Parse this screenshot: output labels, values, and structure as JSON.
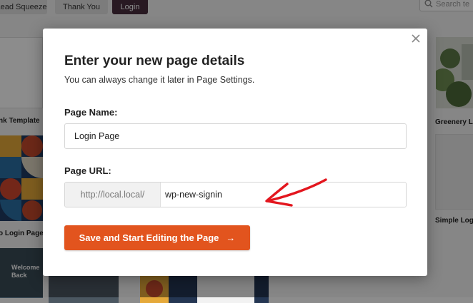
{
  "background": {
    "filter_tabs": [
      {
        "label": "Lead Squeeze"
      },
      {
        "label": "Thank You"
      },
      {
        "label": "Login"
      }
    ],
    "search_placeholder": "Search te",
    "template_labels": {
      "left_top": "nk Template",
      "left_mid": "o Login Page",
      "right_top": "Greenery L",
      "right_mid": "Simple Logi",
      "welcome_text": "Welcome Back"
    }
  },
  "modal": {
    "title": "Enter your new page details",
    "subtitle": "You can always change it later in Page Settings.",
    "page_name": {
      "label": "Page Name:",
      "value": "Login Page"
    },
    "page_url": {
      "label": "Page URL:",
      "prefix": "http://local.local/",
      "value": "wp-new-signin"
    },
    "save_button": {
      "label": "Save and Start Editing the Page",
      "arrow": "→"
    },
    "close_icon": "close-icon"
  },
  "annotation": {
    "arrow_color": "#e3161e",
    "icon": "red-hand-drawn-arrow"
  },
  "colors": {
    "accent": "#e2541e",
    "overlay": "rgba(0,0,0,0.45)"
  }
}
